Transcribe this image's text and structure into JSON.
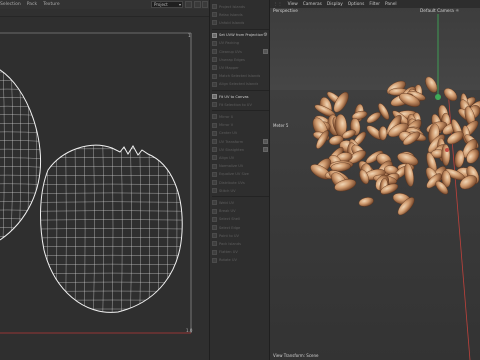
{
  "uv_editor": {
    "menu": [
      "Selection",
      "Pack",
      "Texture"
    ],
    "projection_dropdown": "Project",
    "corner_label_top": "1",
    "corner_label_bottom": "1.0"
  },
  "tools": [
    {
      "label": "Project Islands",
      "active": false
    },
    {
      "label": "Relax Islands",
      "active": false
    },
    {
      "label": "Unfold Islands",
      "active": false
    },
    {
      "label": "Set UVW from Projection",
      "active": true,
      "gear": true
    },
    {
      "label": "UV Packing",
      "active": false
    },
    {
      "label": "Cleanup UVs",
      "active": false,
      "check": true
    },
    {
      "label": "Unwrap Edges",
      "active": false
    },
    {
      "label": "UV Mapper",
      "active": false
    },
    {
      "label": "Match Selected Islands",
      "active": false
    },
    {
      "label": "Align Selected Islands",
      "active": false
    },
    {
      "label": "Fit UV to Canvas",
      "active": true
    },
    {
      "label": "Fit Selection to UV",
      "active": false
    },
    {
      "label": "Mirror U",
      "active": false
    },
    {
      "label": "Mirror V",
      "active": false
    },
    {
      "label": "Center UV",
      "active": false
    },
    {
      "label": "UV Transform",
      "active": false,
      "check": true
    },
    {
      "label": "UV Straighten",
      "active": false,
      "check": true
    },
    {
      "label": "Align UV",
      "active": false
    },
    {
      "label": "Normalize UV",
      "active": false
    },
    {
      "label": "Equalize UV Size",
      "active": false
    },
    {
      "label": "Distribute UVs",
      "active": false
    },
    {
      "label": "Stitch UV",
      "active": false
    },
    {
      "label": "Weld UV",
      "active": false
    },
    {
      "label": "Break UV",
      "active": false
    },
    {
      "label": "Select Shell",
      "active": false
    },
    {
      "label": "Select Edge",
      "active": false
    },
    {
      "label": "Point to UV",
      "active": false
    },
    {
      "label": "Pack Islands",
      "active": false
    },
    {
      "label": "Flatten UV",
      "active": false
    },
    {
      "label": "Rotate UV",
      "active": false
    }
  ],
  "viewport": {
    "menu": [
      "View",
      "Cameras",
      "Display",
      "Options",
      "Filter",
      "Panel"
    ],
    "view_label": "Perspective",
    "camera_label": "Default Camera",
    "camera_suffix": "☼",
    "grid_spacing": "Meter",
    "grid_spacing_value": "5",
    "footer": "View Transform: Scene"
  },
  "colors": {
    "accent_active": "#d0d0d0",
    "axis_green": "#3fb35a",
    "axis_red": "#c0413b",
    "uv_wire": "#e8e8e8",
    "uv_bounds_red": "#b83a3a",
    "seed_light": "#d9b08a",
    "seed_dark": "#7a4a2e"
  },
  "icons": [
    "gear-icon",
    "checkbox-icon",
    "dropdown-arrow-icon",
    "axis-gizmo-icon",
    "camera-icon"
  ]
}
